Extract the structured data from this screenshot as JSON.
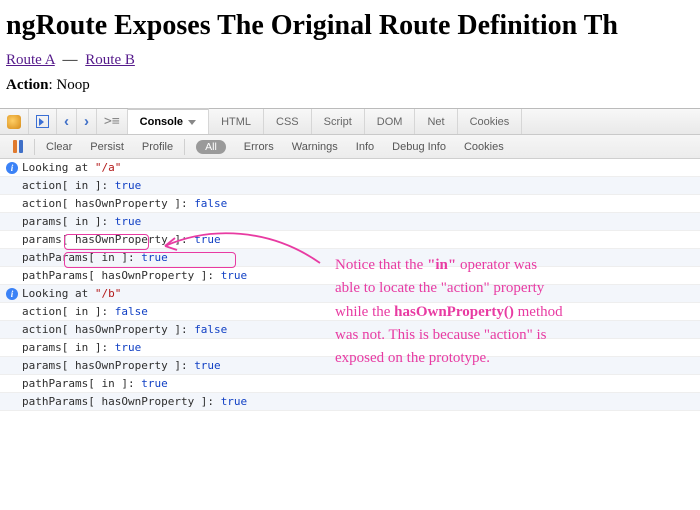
{
  "page": {
    "title": "ngRoute Exposes The Original Route Definition Th",
    "links": {
      "route_a": "Route A",
      "route_b": "Route B",
      "sep": "—"
    },
    "action_label": "Action",
    "action_value": "Noop"
  },
  "devtools": {
    "tabs": {
      "console": "Console",
      "html": "HTML",
      "css": "CSS",
      "script": "Script",
      "dom": "DOM",
      "net": "Net",
      "cookies": "Cookies"
    },
    "subbar": {
      "clear": "Clear",
      "persist": "Persist",
      "profile": "Profile",
      "all": "All",
      "errors": "Errors",
      "warnings": "Warnings",
      "info": "Info",
      "debug_info": "Debug Info",
      "cookies": "Cookies"
    }
  },
  "console_rows": [
    {
      "info": true,
      "prefix": "Looking at ",
      "path": "\"/a\"",
      "tail": ""
    },
    {
      "info": false,
      "prefix": "action[ in ]: ",
      "bool": "true"
    },
    {
      "info": false,
      "prefix": "action[ hasOwnProperty ]: ",
      "bool": "false"
    },
    {
      "info": false,
      "prefix": "params[ in ]: ",
      "bool": "true"
    },
    {
      "info": false,
      "prefix": "params[ hasOwnProperty ]: ",
      "bool": "true"
    },
    {
      "info": false,
      "prefix": "pathParams[ in ]: ",
      "bool": "true"
    },
    {
      "info": false,
      "prefix": "pathParams[ hasOwnProperty ]: ",
      "bool": "true"
    },
    {
      "info": true,
      "prefix": "Looking at ",
      "path": "\"/b\"",
      "tail": ""
    },
    {
      "info": false,
      "prefix": "action[ in ]: ",
      "bool": "false"
    },
    {
      "info": false,
      "prefix": "action[ hasOwnProperty ]: ",
      "bool": "false"
    },
    {
      "info": false,
      "prefix": "params[ in ]: ",
      "bool": "true"
    },
    {
      "info": false,
      "prefix": "params[ hasOwnProperty ]: ",
      "bool": "true"
    },
    {
      "info": false,
      "prefix": "pathParams[ in ]: ",
      "bool": "true"
    },
    {
      "info": false,
      "prefix": "pathParams[ hasOwnProperty ]: ",
      "bool": "true"
    }
  ],
  "annotation": {
    "l1a": "Notice that the ",
    "l1kw": "\"in\"",
    "l1b": " operator was",
    "l2": "able to locate the \"action\" property",
    "l3a": "while the ",
    "l3kw": "hasOwnProperty()",
    "l3b": " method",
    "l4": "was not. This is because \"action\" is",
    "l5": "exposed on the prototype."
  }
}
